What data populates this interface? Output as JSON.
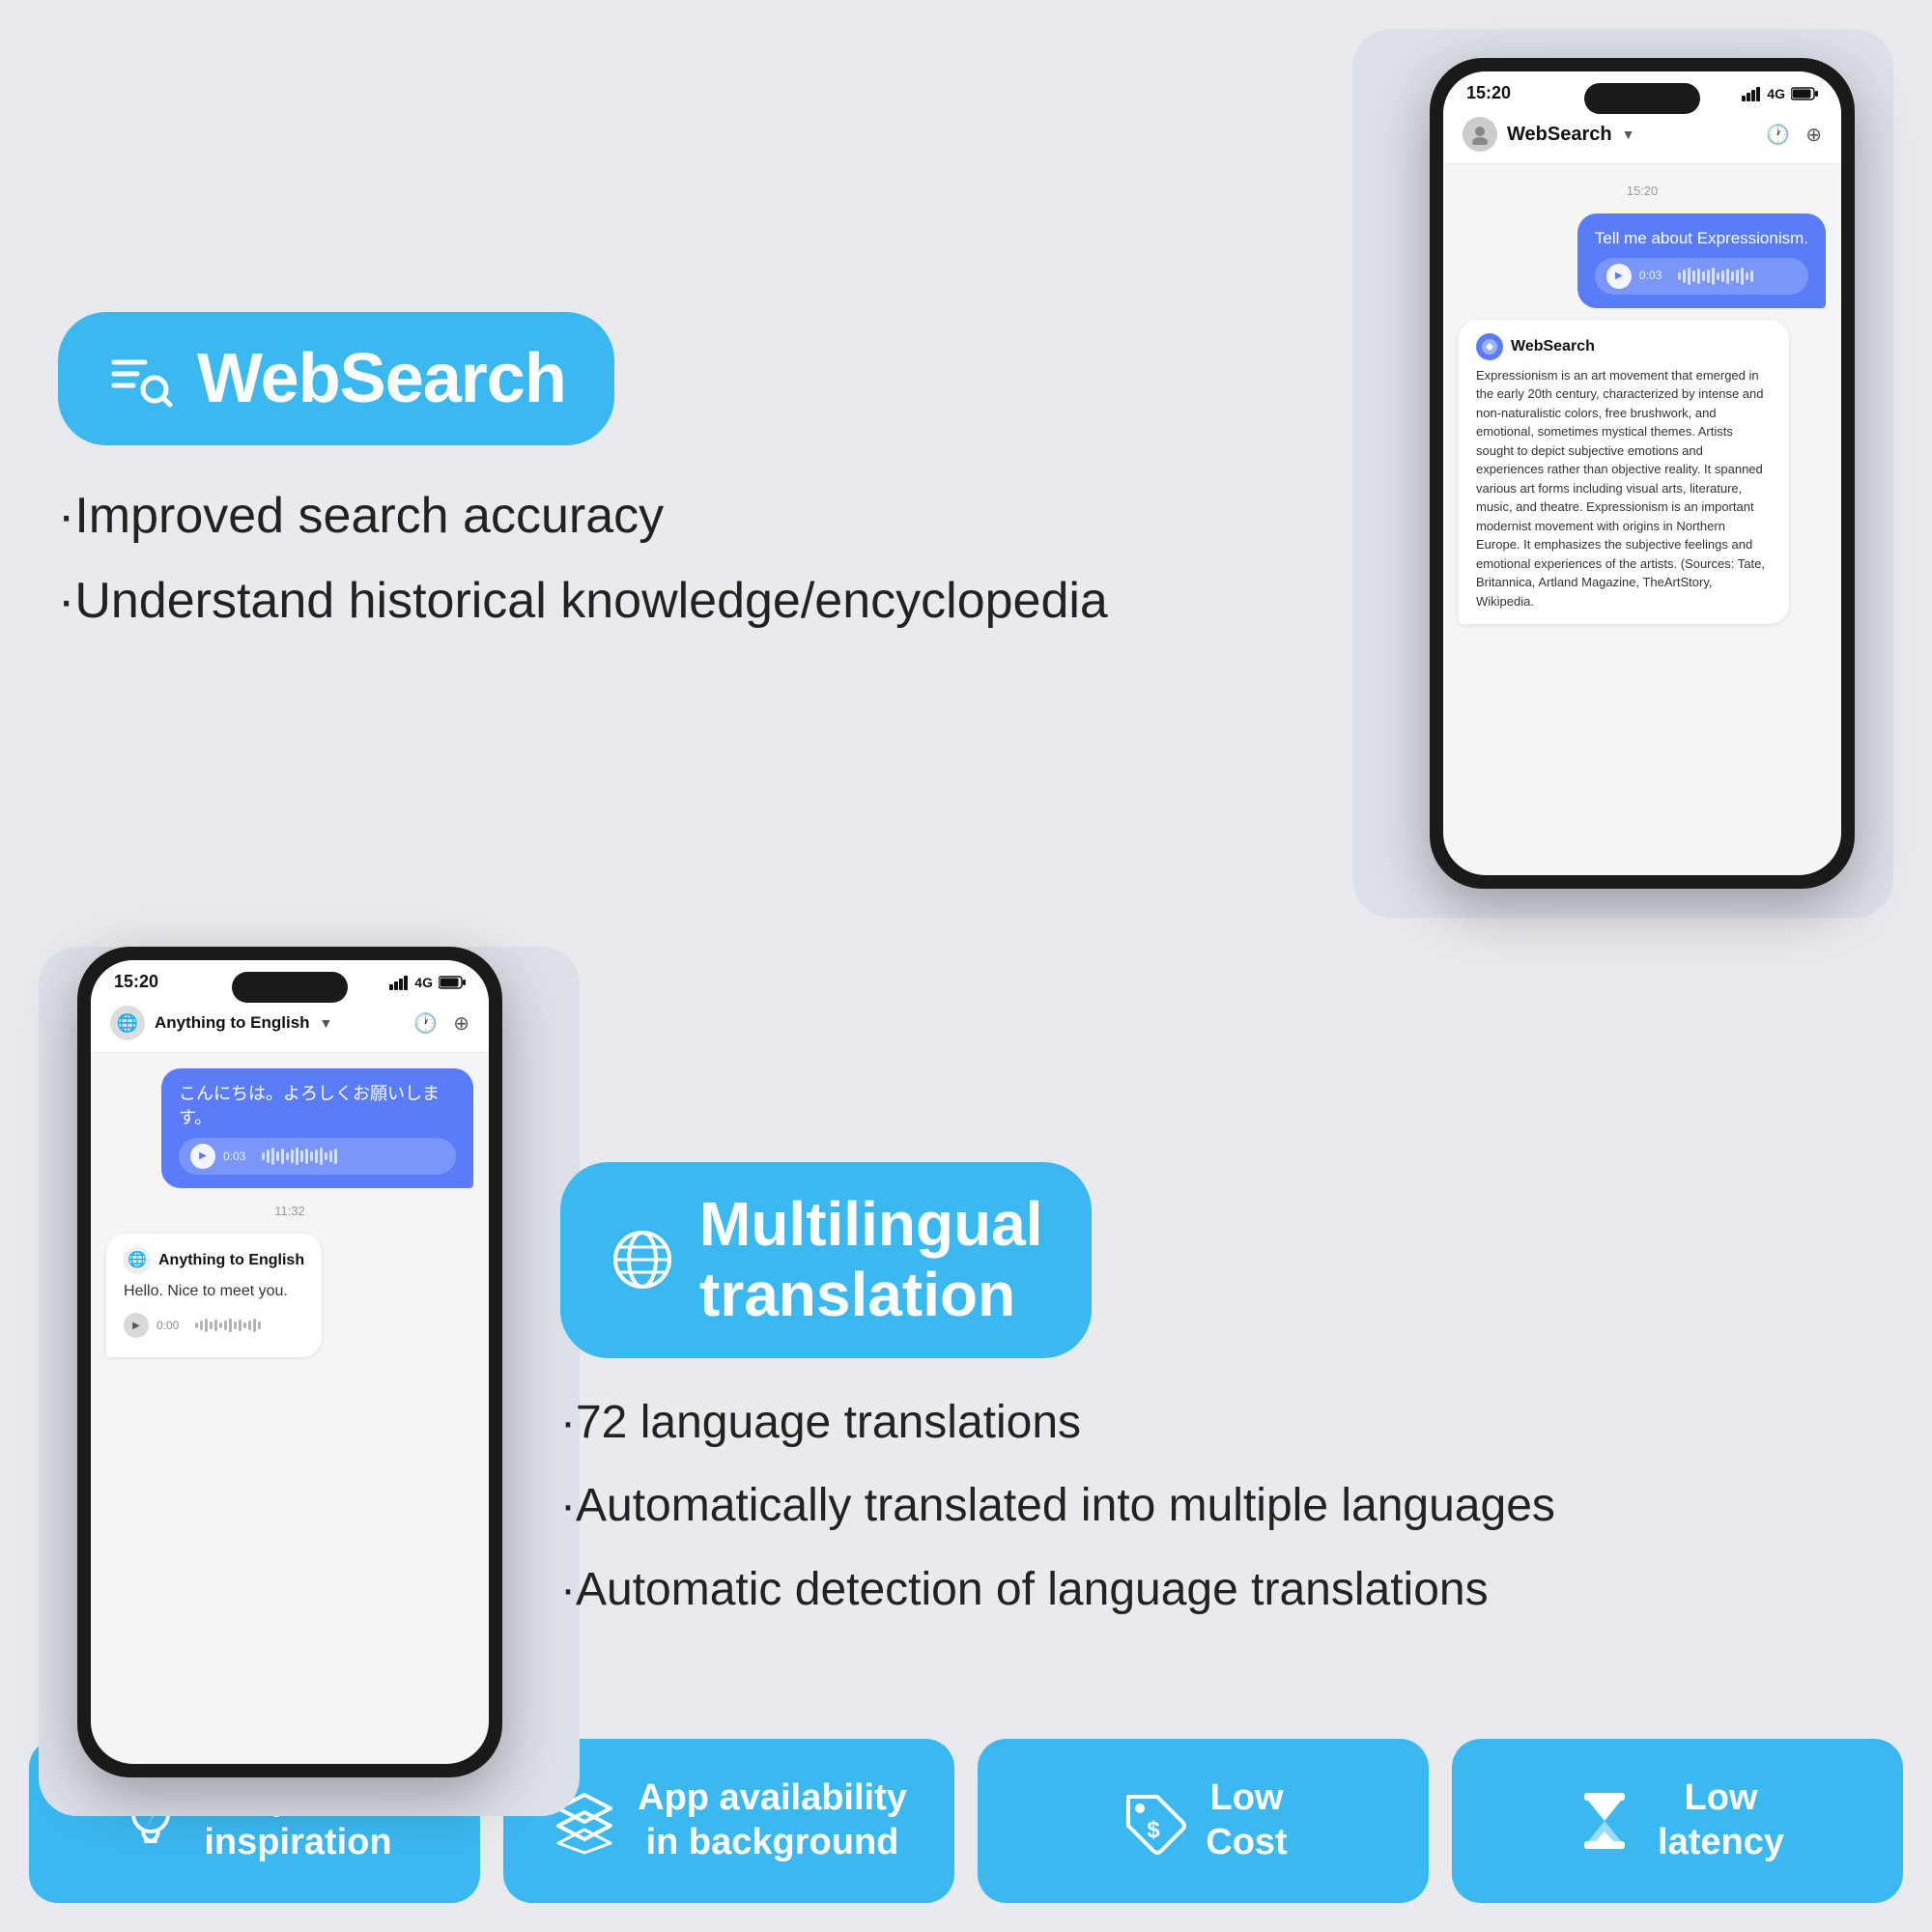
{
  "app": {
    "background_color": "#e8eaed"
  },
  "websearch": {
    "badge_label": "WebSearch",
    "bullet1": "·Improved search accuracy",
    "bullet2": "·Understand historical knowledge/encyclopedia"
  },
  "phone1": {
    "time": "15:20",
    "signal": "4G",
    "contact": "WebSearch",
    "msg_time": "15:20",
    "user_msg": "Tell me about Expressionism.",
    "audio_time_user": "0:03",
    "sender_name": "WebSearch",
    "ai_response": "Expressionism is an art movement that emerged in the early 20th century, characterized by intense and non-naturalistic colors, free brushwork, and emotional, sometimes mystical themes. Artists sought to depict subjective emotions and experiences rather than objective reality. It spanned various art forms including visual arts, literature, music, and theatre. Expressionism is an important modernist movement with origins in Northern Europe. It emphasizes the subjective feelings and emotional experiences of the artists. (Sources: Tate, Britannica, Artland Magazine, TheArtStory, Wikipedia."
  },
  "phone2": {
    "time": "15:20",
    "signal": "4G",
    "contact": "Anything to English",
    "msg_japanese": "こんにちは。よろしくお願いします。",
    "audio_time_jp": "0:03",
    "msg_time2": "11:32",
    "sender_name2": "Anything to English",
    "english_msg": "Hello. Nice to meet you.",
    "audio_time_en": "0:00"
  },
  "translation": {
    "badge_label": "Multilingual\ntranslation",
    "bullet1": "·72 language translations",
    "bullet2": "·Automatically translated into multiple languages",
    "bullet3": "·Automatic detection of language translations"
  },
  "footer": {
    "card1_label": "Spark\ninspiration",
    "card2_label": "App availability\nin background",
    "card3_label": "Low\nCost",
    "card4_label": "Low\nlatency"
  }
}
